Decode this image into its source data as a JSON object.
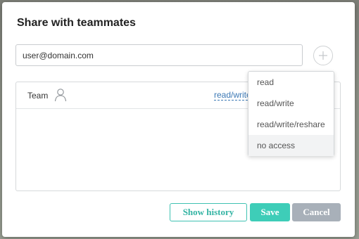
{
  "dialog": {
    "title": "Share with teammates"
  },
  "email_input": {
    "value": "user@domain.com",
    "placeholder": ""
  },
  "add_button": {
    "icon": "plus-icon"
  },
  "team_row": {
    "label": "Team",
    "icon": "user-icon",
    "permission": "read/write"
  },
  "permission_menu": {
    "items": [
      {
        "label": "read"
      },
      {
        "label": "read/write"
      },
      {
        "label": "read/write/reshare"
      },
      {
        "label": "no access"
      }
    ],
    "highlighted": "no access"
  },
  "buttons": {
    "show_history": "Show history",
    "save": "Save",
    "cancel": "Cancel"
  },
  "colors": {
    "accent": "#3ecdb8",
    "link": "#3b78b5",
    "cancel": "#a8b0b9"
  }
}
